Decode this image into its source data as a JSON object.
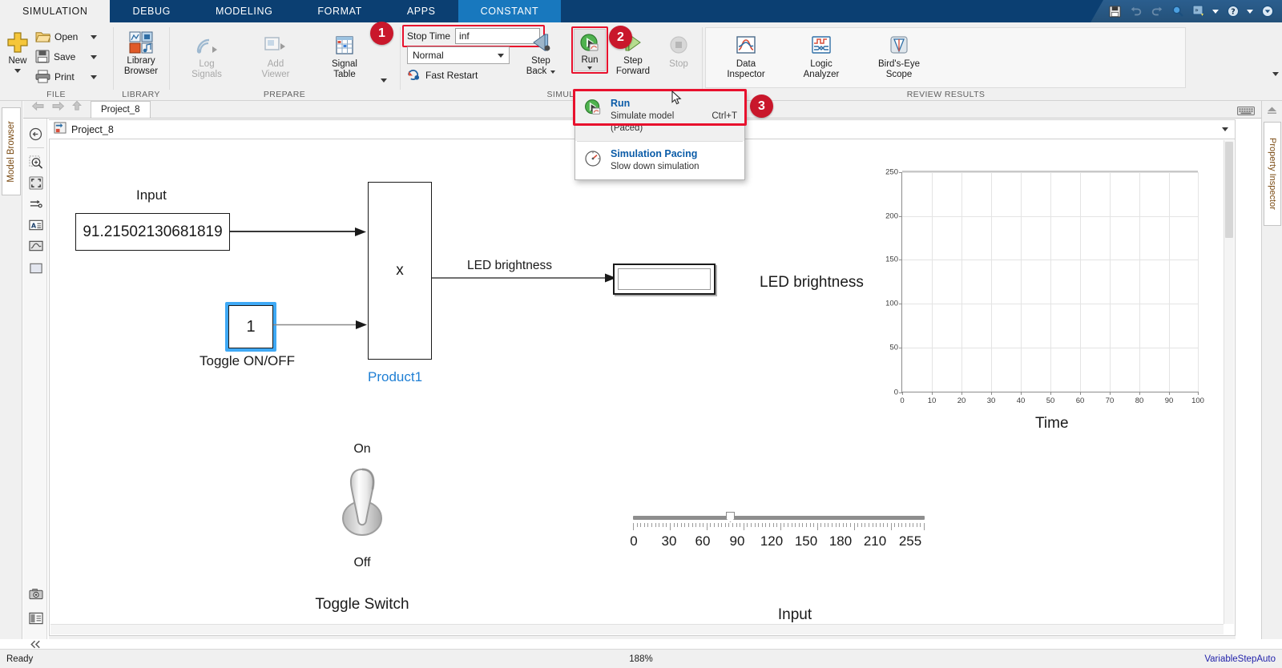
{
  "ribbon": {
    "tabs": [
      {
        "label": "SIMULATION",
        "state": "active-white"
      },
      {
        "label": "DEBUG",
        "state": "normal"
      },
      {
        "label": "MODELING",
        "state": "normal"
      },
      {
        "label": "FORMAT",
        "state": "normal"
      },
      {
        "label": "APPS",
        "state": "normal"
      },
      {
        "label": "CONSTANT",
        "state": "active-blue"
      }
    ],
    "groups": {
      "file": {
        "label": "FILE",
        "new": "New",
        "open": "Open",
        "save": "Save",
        "print": "Print"
      },
      "library": {
        "label": "LIBRARY",
        "library_browser": "Library\nBrowser",
        "library_browser_l1": "Library",
        "library_browser_l2": "Browser"
      },
      "prepare": {
        "label": "PREPARE",
        "log_signals_l1": "Log",
        "log_signals_l2": "Signals",
        "add_viewer_l1": "Add",
        "add_viewer_l2": "Viewer",
        "signal_table_l1": "Signal",
        "signal_table_l2": "Table"
      },
      "simulate": {
        "label": "SIMULATE",
        "stop_time_label": "Stop Time",
        "stop_time_value": "inf",
        "mode_value": "Normal",
        "fast_restart": "Fast Restart",
        "step_back_l1": "Step",
        "step_back_l2": "Back",
        "run": "Run",
        "step_forward_l1": "Step",
        "step_forward_l2": "Forward",
        "stop": "Stop"
      },
      "review": {
        "label": "REVIEW RESULTS",
        "data_inspector_l1": "Data",
        "data_inspector_l2": "Inspector",
        "logic_analyzer_l1": "Logic",
        "logic_analyzer_l2": "Analyzer",
        "birds_eye_l1": "Bird's-Eye",
        "birds_eye_l2": "Scope"
      }
    }
  },
  "annotations": {
    "badge1": "1",
    "badge2": "2",
    "badge3": "3",
    "highlight_color": "#e8112d"
  },
  "run_menu": {
    "items": [
      {
        "title": "Run",
        "subtitle": "Simulate model (Paced)",
        "shortcut": "Ctrl+T",
        "icon": "run-green-icon",
        "highlighted": true
      },
      {
        "title": "Simulation Pacing",
        "subtitle": "Slow down simulation",
        "shortcut": "",
        "icon": "pacing-gauge-icon",
        "highlighted": false
      }
    ]
  },
  "panels": {
    "left_tab": "Model Browser",
    "right_tab": "Property Inspector"
  },
  "editor": {
    "tab_label": "Project_8",
    "breadcrumb": "Project_8"
  },
  "model": {
    "constant_input": {
      "label": "Input",
      "value": "91.21502130681819"
    },
    "toggle_const": {
      "label": "Toggle ON/OFF",
      "value": "1",
      "selected": true
    },
    "product": {
      "label": "Product1",
      "symbol": "x"
    },
    "signal_label": "LED brightness",
    "display_block": {
      "value": ""
    },
    "scope_title": "LED brightness",
    "toggle_switch": {
      "on_label": "On",
      "off_label": "Off",
      "caption": "Toggle Switch",
      "position": "On"
    },
    "slider": {
      "caption": "Input",
      "value": 90,
      "min": 0,
      "max": 255,
      "tick_labels": [
        "0",
        "30",
        "60",
        "90",
        "120",
        "150",
        "180",
        "210",
        "255"
      ]
    }
  },
  "chart_data": {
    "type": "line",
    "title": "LED brightness",
    "xlabel": "Time",
    "ylabel": "",
    "xlim": [
      0,
      100
    ],
    "ylim": [
      0,
      255
    ],
    "xticks": [
      0,
      10,
      20,
      30,
      40,
      50,
      60,
      70,
      80,
      90,
      100
    ],
    "yticks": [
      0,
      50,
      100,
      150,
      200,
      250
    ],
    "grid": true,
    "legend": "none",
    "series": [
      {
        "name": "LED brightness",
        "x": [],
        "y": []
      }
    ]
  },
  "status": {
    "ready": "Ready",
    "zoom": "188%",
    "solver": "VariableStepAuto"
  }
}
